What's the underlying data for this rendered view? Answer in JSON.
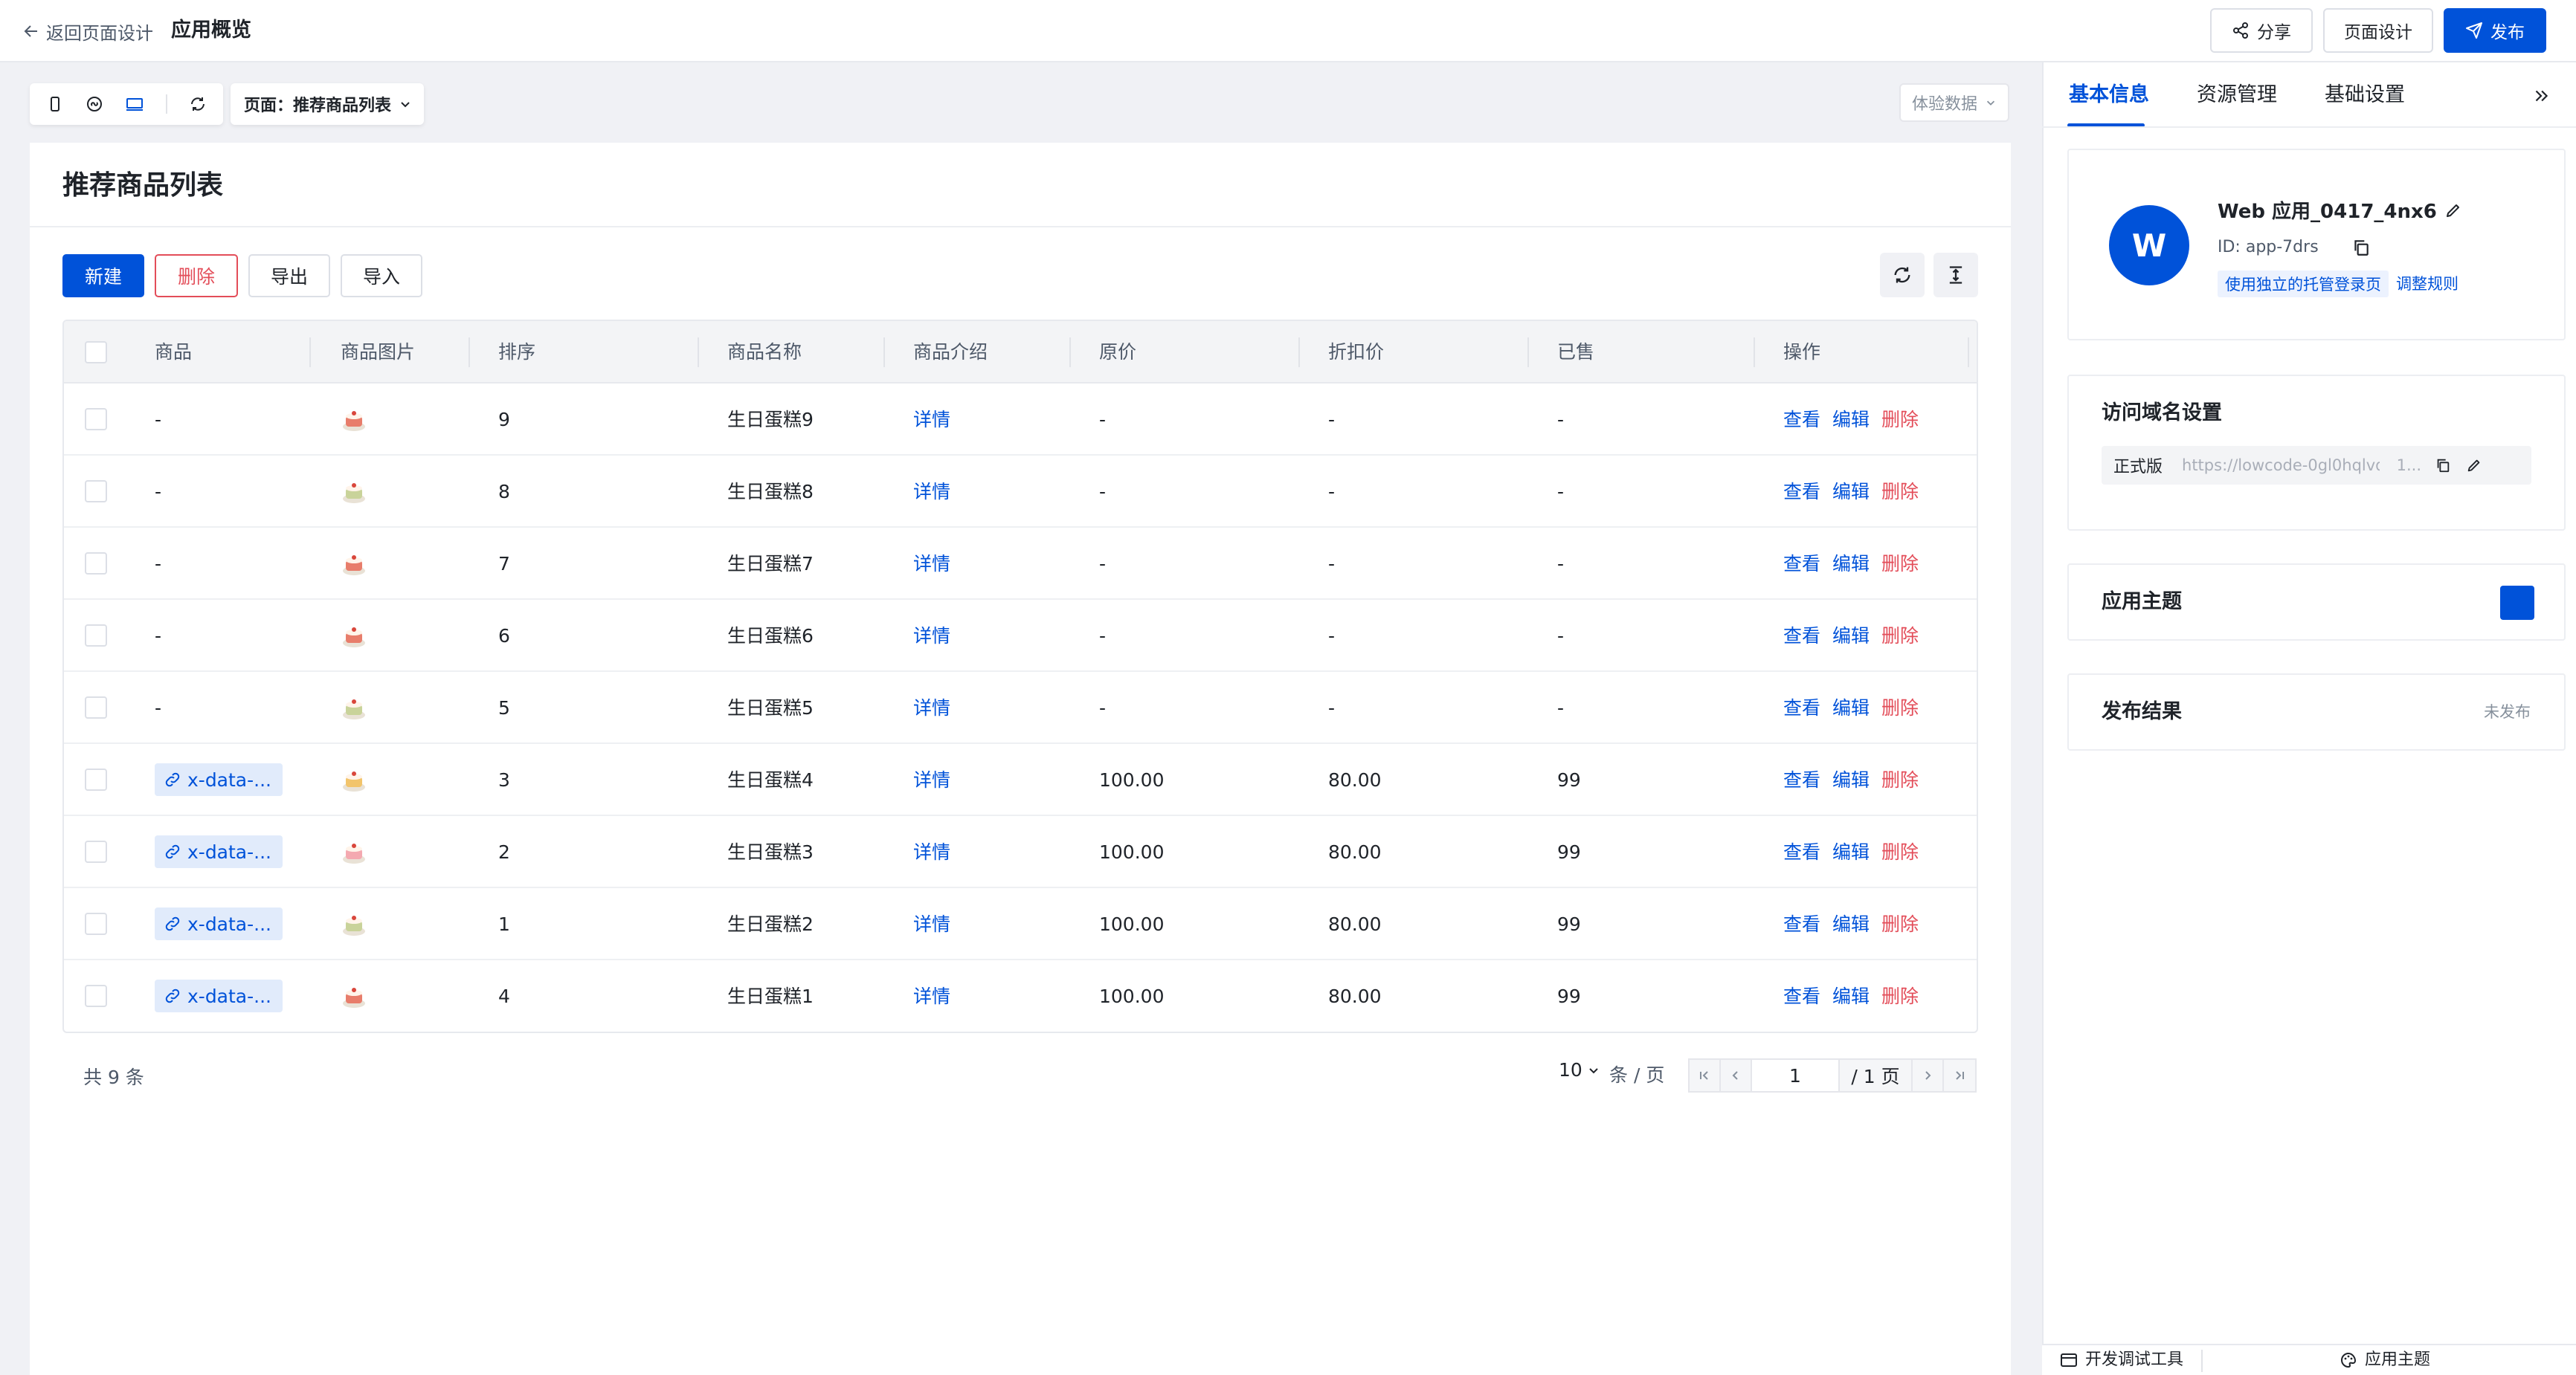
{
  "header": {
    "back_label": "返回页面设计",
    "app_title": "应用概览",
    "share_label": "分享",
    "page_design_label": "页面设计",
    "publish_label": "发布"
  },
  "canvas": {
    "page_selector": "页面：推荐商品列表",
    "experience_data": "体验数据",
    "page_title": "推荐商品列表",
    "toolbar": {
      "new": "新建",
      "delete": "删除",
      "export": "导出",
      "import": "导入"
    },
    "table": {
      "headers": [
        "商品",
        "商品图片",
        "排序",
        "商品名称",
        "商品介绍",
        "原价",
        "折扣价",
        "已售",
        "操作"
      ],
      "detail_label": "详情",
      "actions": {
        "view": "查看",
        "edit": "编辑",
        "delete": "删除"
      },
      "rows": [
        {
          "product": "-",
          "image_color": "#e87d6b",
          "sort": "9",
          "name": "生日蛋糕9",
          "price": "-",
          "discount": "-",
          "sold": "-"
        },
        {
          "product": "-",
          "image_color": "#c9d39a",
          "sort": "8",
          "name": "生日蛋糕8",
          "price": "-",
          "discount": "-",
          "sold": "-"
        },
        {
          "product": "-",
          "image_color": "#e87d6b",
          "sort": "7",
          "name": "生日蛋糕7",
          "price": "-",
          "discount": "-",
          "sold": "-"
        },
        {
          "product": "-",
          "image_color": "#e87d6b",
          "sort": "6",
          "name": "生日蛋糕6",
          "price": "-",
          "discount": "-",
          "sold": "-"
        },
        {
          "product": "-",
          "image_color": "#c9d39a",
          "sort": "5",
          "name": "生日蛋糕5",
          "price": "-",
          "discount": "-",
          "sold": "-"
        },
        {
          "product": "x-data-...",
          "image_color": "#f2c46b",
          "sort": "3",
          "name": "生日蛋糕4",
          "price": "100.00",
          "discount": "80.00",
          "sold": "99"
        },
        {
          "product": "x-data-...",
          "image_color": "#f4a9b0",
          "sort": "2",
          "name": "生日蛋糕3",
          "price": "100.00",
          "discount": "80.00",
          "sold": "99"
        },
        {
          "product": "x-data-...",
          "image_color": "#c9d39a",
          "sort": "1",
          "name": "生日蛋糕2",
          "price": "100.00",
          "discount": "80.00",
          "sold": "99"
        },
        {
          "product": "x-data-...",
          "image_color": "#e87d6b",
          "sort": "4",
          "name": "生日蛋糕1",
          "price": "100.00",
          "discount": "80.00",
          "sold": "99"
        }
      ]
    },
    "pagination": {
      "total": "共 9 条",
      "page_size": "10",
      "per_page": "条 / 页",
      "current_page": "1",
      "total_pages": "/ 1 页"
    }
  },
  "panel": {
    "tabs": [
      "基本信息",
      "资源管理",
      "基础设置"
    ],
    "app": {
      "avatar": "W",
      "name": "Web 应用_0417_4nx6",
      "id": "ID: app-7drs",
      "hosted_login": "使用独立的托管登录页",
      "adjust_rules": "调整规则"
    },
    "domain": {
      "title": "访问域名设置",
      "env_label": "正式版",
      "url": "https://lowcode-0gl0hqlvd...",
      "url_tail": "1..."
    },
    "theme": {
      "title": "应用主题",
      "color": "#0052d9"
    },
    "publish": {
      "title": "发布结果",
      "status": "未发布"
    }
  },
  "footer": {
    "dev_tools": "开发调试工具",
    "app_theme": "应用主题"
  }
}
